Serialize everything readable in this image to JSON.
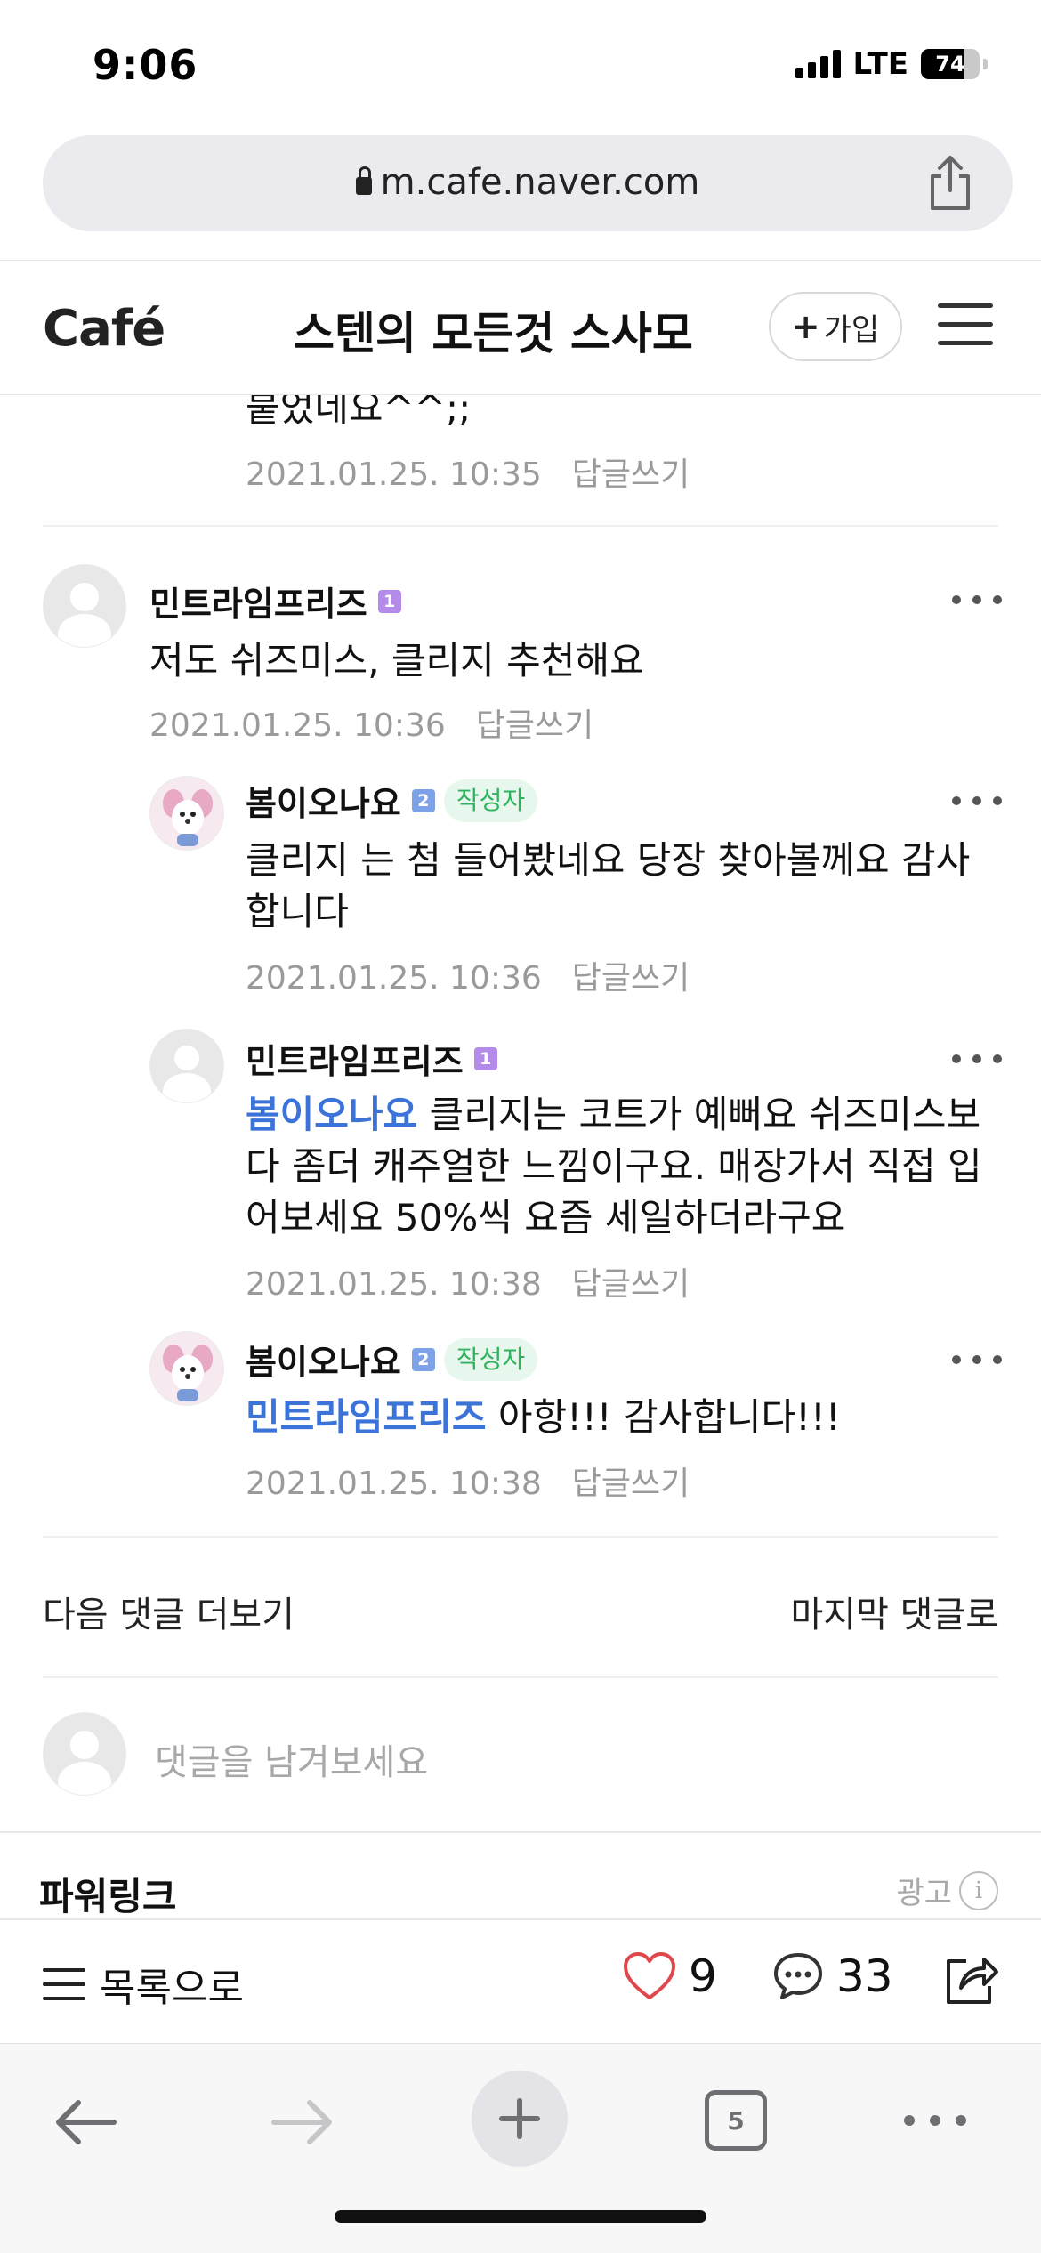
{
  "status": {
    "time": "9:06",
    "network": "LTE",
    "battery": "74",
    "battery_level": 0.74
  },
  "browser": {
    "url": "m.cafe.naver.com",
    "tab_count": "5"
  },
  "header": {
    "logo": "Café",
    "title": "스텐의 모든것 스사모",
    "join_label": "가입"
  },
  "comments": [
    {
      "text": "붙었네요^^;;",
      "date": "2021.01.25. 10:35",
      "reply": "답글쓰기"
    },
    {
      "nick": "민트라임프리즈",
      "level": "1",
      "text": "저도 쉬즈미스, 클리지 추천해요",
      "date": "2021.01.25. 10:36",
      "reply": "답글쓰기"
    },
    {
      "nick": "봄이오나요",
      "level": "2",
      "badge": "작성자",
      "text": "클리지 는 첨 들어봤네요 당장 찾아볼께요 감사합니다",
      "date": "2021.01.25. 10:36",
      "reply": "답글쓰기"
    },
    {
      "nick": "민트라임프리즈",
      "level": "1",
      "mention": "봄이오나요",
      "text": " 클리지는 코트가 예뻐요 쉬즈미스보다 좀더 캐주얼한 느낌이구요. 매장가서 직접 입어보세요 50%씩 요즘 세일하더라구요",
      "date": "2021.01.25. 10:38",
      "reply": "답글쓰기"
    },
    {
      "nick": "봄이오나요",
      "level": "2",
      "badge": "작성자",
      "mention": "민트라임프리즈",
      "text": " 아항!!! 감사합니다!!!",
      "date": "2021.01.25. 10:38",
      "reply": "답글쓰기"
    }
  ],
  "more": {
    "next": "다음 댓글 더보기",
    "last": "마지막 댓글로"
  },
  "input": {
    "placeholder": "댓글을 남겨보세요"
  },
  "powerlink": {
    "title": "파워링크",
    "ad": "광고",
    "info": "i"
  },
  "bottom": {
    "list_label": "목록으로",
    "likes": "9",
    "comments": "33"
  },
  "colors": {
    "accent_green": "#2fb35e",
    "mention_blue": "#3b73d8",
    "heart_red": "#e0474c"
  }
}
